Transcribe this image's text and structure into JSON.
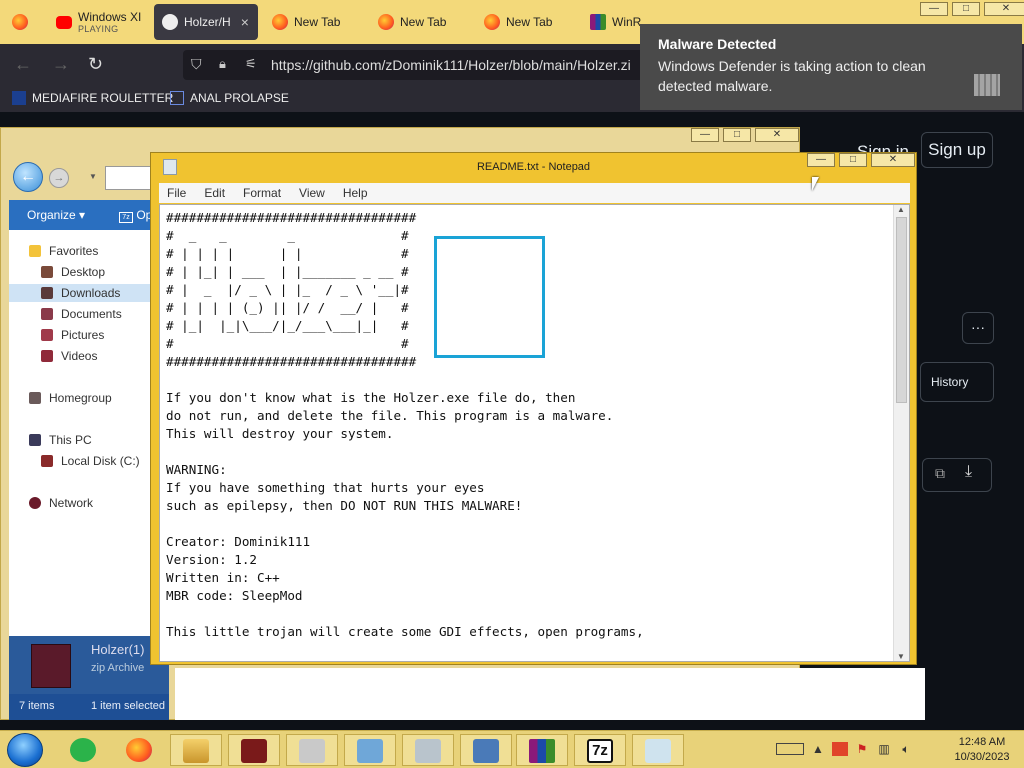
{
  "browser": {
    "tabs": [
      {
        "title": "Windows XI",
        "subtitle": "PLAYING",
        "icon": "youtube-icon"
      },
      {
        "title": "Holzer/H",
        "icon": "github-icon"
      },
      {
        "title": "New Tab",
        "icon": "firefox-icon"
      },
      {
        "title": "New Tab",
        "icon": "firefox-icon"
      },
      {
        "title": "New Tab",
        "icon": "firefox-icon"
      },
      {
        "title": "WinRAR",
        "icon": "winrar-icon"
      }
    ],
    "url": "https://github.com/zDominik111/Holzer/blob/main/Holzer.zi",
    "bookmarks": [
      "MEDIAFIRE ROULETTER",
      "ANAL PROLAPSE"
    ],
    "tab_close_glyph": "×"
  },
  "github": {
    "sign_in": "Sign in",
    "sign_up": "Sign up",
    "history_label": "History",
    "more_glyph": "···"
  },
  "explorer": {
    "toolbar": {
      "organize": "Organize",
      "open_with": "Op"
    },
    "tree": {
      "favorites": "Favorites",
      "desktop": "Desktop",
      "downloads": "Downloads",
      "documents": "Documents",
      "pictures": "Pictures",
      "videos": "Videos",
      "homegroup": "Homegroup",
      "this_pc": "This PC",
      "local_disk": "Local Disk (C:)",
      "network": "Network"
    },
    "preview": {
      "name": "Holzer(1)",
      "type": "zip Archive"
    },
    "status": {
      "items": "7 items",
      "selected": "1 item selected"
    }
  },
  "notepad": {
    "title": "README.txt - Notepad",
    "menu": [
      "File",
      "Edit",
      "Format",
      "View",
      "Help"
    ],
    "text": "#################################\n#  _   _        _              #\n# | | | |      | |             #\n# | |_| | ___  | |_______ _ __ #\n# |  _  |/ _ \\ | |_  / _ \\ '__|#\n# | | | | (_) || |/ /  __/ |   #\n# |_|  |_|\\___/|_/___\\___|_|   #\n#                              #\n#################################\n\nIf you don't know what is the Holzer.exe file do, then\ndo not run, and delete the file. This program is a malware.\nThis will destroy your system.\n\nWARNING:\nIf you have something that hurts your eyes\nsuch as epilepsy, then DO NOT RUN THIS MALWARE!\n\nCreator: Dominik111\nVersion: 1.2\nWritten in: C++\nMBR code: SleepMod\n\nThis little trojan will create some GDI effects, open programs,"
  },
  "toast": {
    "title": "Malware Detected",
    "body": "Windows Defender is taking action to clean detected malware."
  },
  "taskbar": {
    "apps": [
      "firefox-icon",
      "file-explorer-icon",
      "game-icon",
      "recycle-icon",
      "people-icon",
      "calculator-icon",
      "remote-desktop-icon",
      "winrar-icon",
      "7zip-icon",
      "notepad-icon"
    ],
    "sevenzip_label": "7z",
    "clock_time": "12:48 AM",
    "clock_date": "10/30/2023"
  }
}
